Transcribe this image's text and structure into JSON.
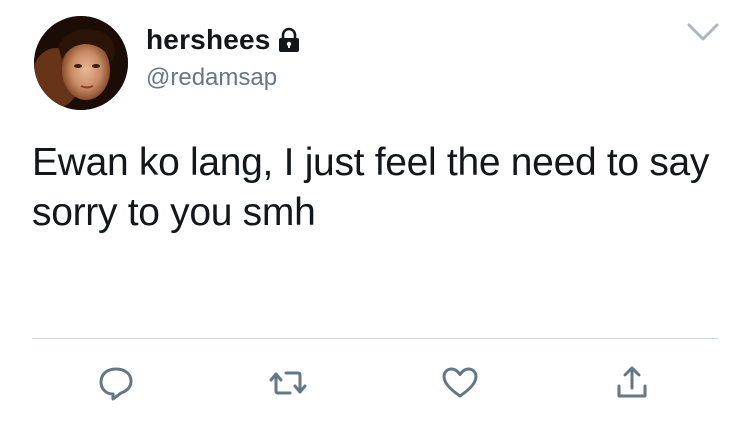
{
  "tweet": {
    "display_name": "hershees",
    "handle": "@redamsap",
    "text": "Ewan ko lang, I just feel the need to say sorry to you smh",
    "protected": true
  },
  "icons": {
    "account": "lock-icon",
    "menu": "chevron-down-icon",
    "reply": "reply-icon",
    "retweet": "retweet-icon",
    "like": "heart-icon",
    "share": "share-icon"
  },
  "colors": {
    "text": "#14171a",
    "secondary": "#657786",
    "icon": "#657786",
    "divider": "#cfd6dc"
  }
}
